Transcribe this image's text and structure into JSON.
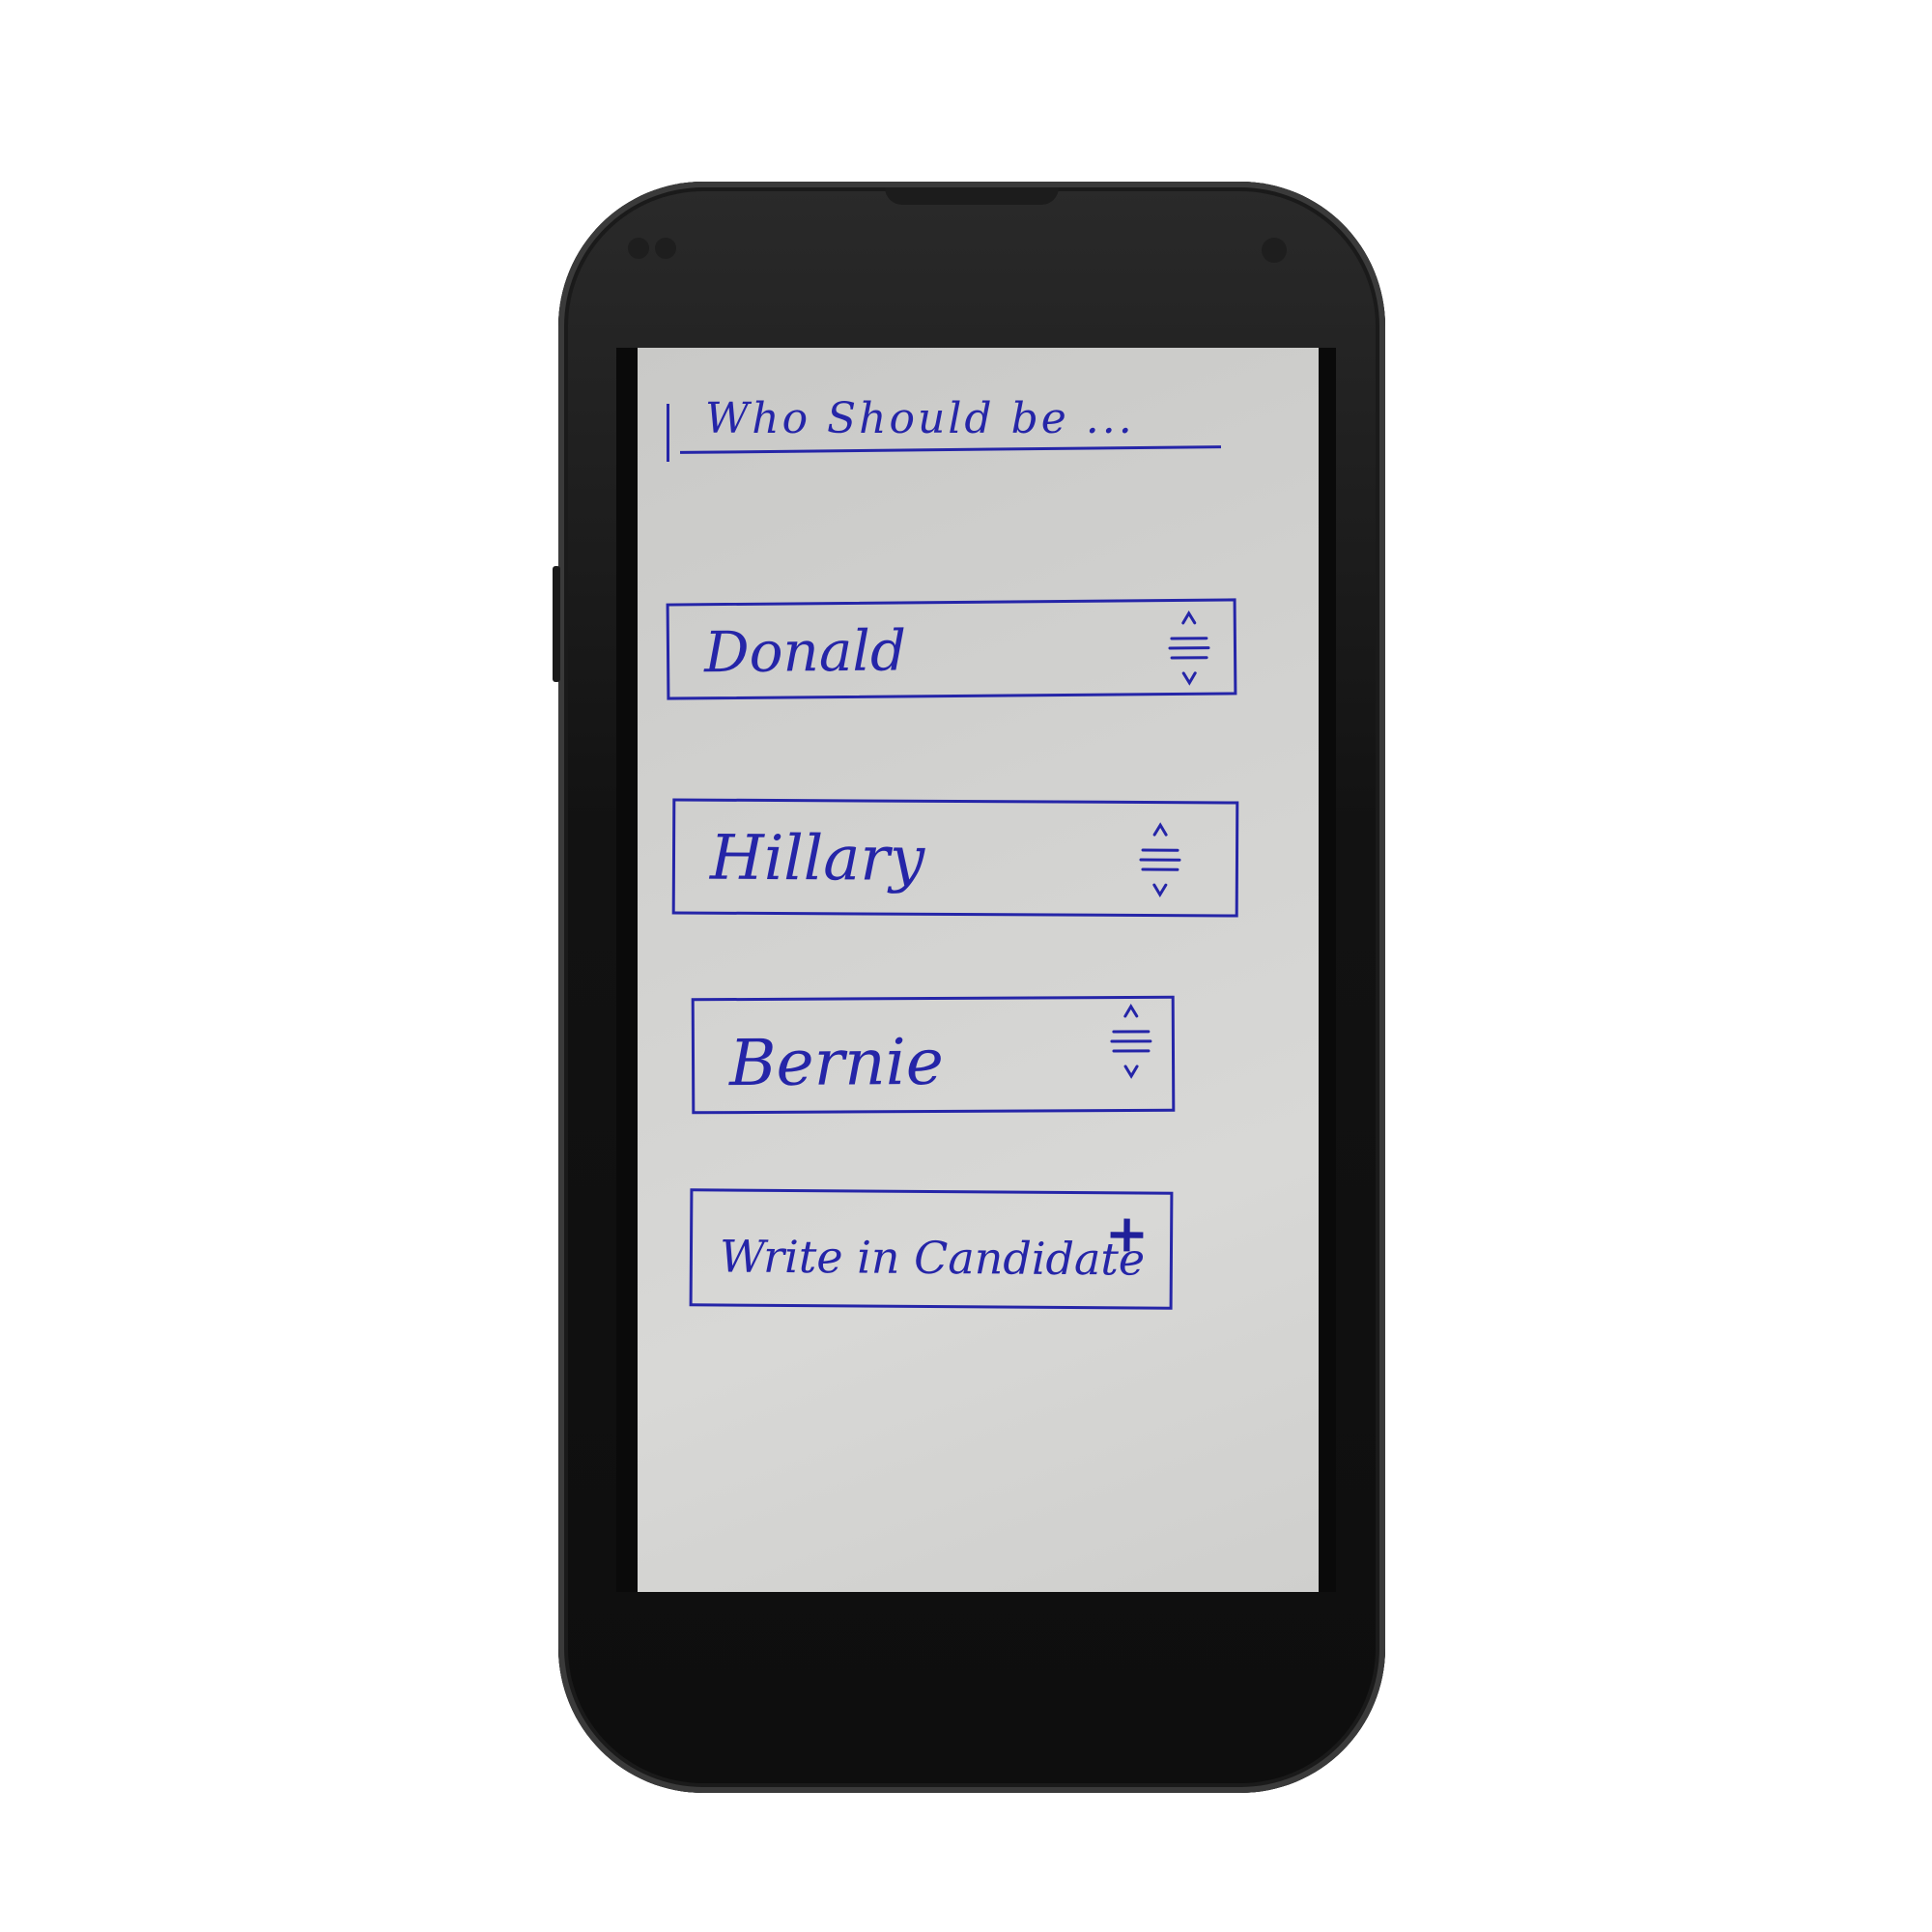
{
  "heading": "Who Should be ...",
  "options": [
    {
      "label": "Donald"
    },
    {
      "label": "Hillary"
    },
    {
      "label": "Bernie"
    }
  ],
  "write_in": {
    "label": "Write in Candidate"
  },
  "icons": {
    "sort": "sort-updown-icon",
    "add": "plus-icon"
  },
  "colors": {
    "ink": "#2525a8",
    "paper": "#d2d2d0",
    "phone": "#121212"
  }
}
